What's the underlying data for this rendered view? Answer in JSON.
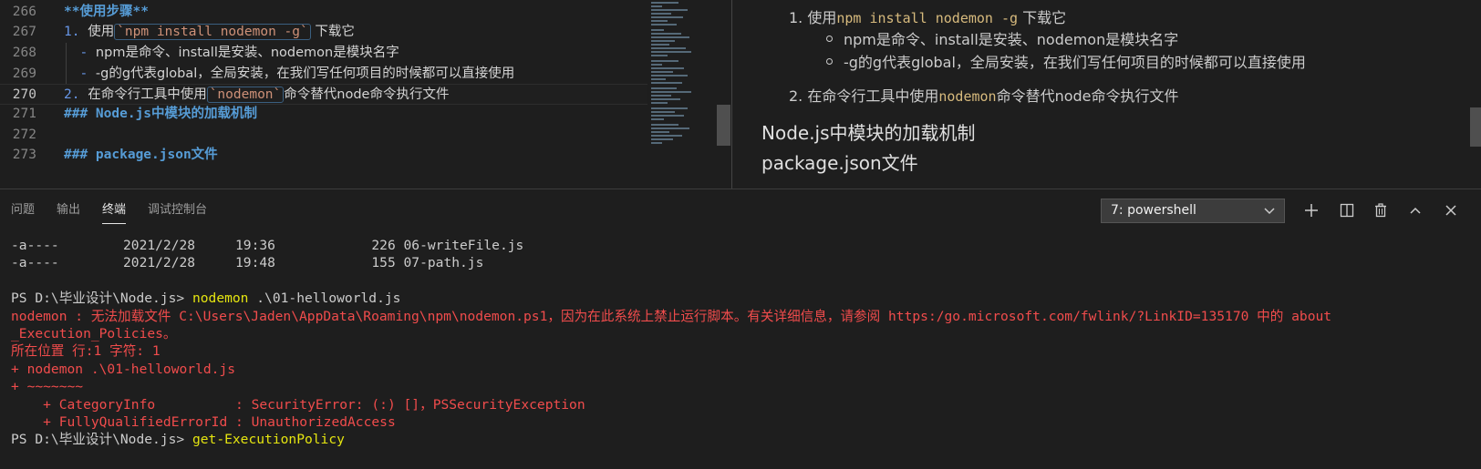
{
  "editor": {
    "lines": [
      {
        "num": "266",
        "parts": [
          {
            "t": "**使用步骤**",
            "c": "bold-cyan"
          }
        ]
      },
      {
        "num": "267",
        "parts": [
          {
            "t": "1. ",
            "c": "list-num"
          },
          {
            "t": "使用",
            "c": "plain cn"
          },
          {
            "t": "`npm install nodemon -g`",
            "c": "inline-code"
          },
          {
            "t": " 下载它",
            "c": "plain cn"
          }
        ]
      },
      {
        "num": "268",
        "parts": [
          {
            "t": "  - ",
            "c": "list-num"
          },
          {
            "t": "npm是命令、install是安装、nodemon是模块名字",
            "c": "plain cn"
          }
        ]
      },
      {
        "num": "269",
        "parts": [
          {
            "t": "  - ",
            "c": "list-num"
          },
          {
            "t": "-g的g代表global，全局安装，在我们写任何项目的时候都可以直接使用",
            "c": "plain cn"
          }
        ]
      },
      {
        "num": "270",
        "parts": [
          {
            "t": "2. ",
            "c": "list-num"
          },
          {
            "t": "在命令行工具中使用",
            "c": "plain cn"
          },
          {
            "t": "`nodemon`",
            "c": "inline-code"
          },
          {
            "t": "命令替代node命令执行文件",
            "c": "plain cn"
          }
        ]
      },
      {
        "num": "271",
        "parts": [
          {
            "t": "### Node.js中模块的加载机制",
            "c": "heading"
          }
        ]
      },
      {
        "num": "272",
        "parts": []
      },
      {
        "num": "273",
        "parts": [
          {
            "t": "### package.json文件",
            "c": "heading"
          }
        ]
      }
    ],
    "current_line": "270"
  },
  "preview": {
    "item1_prefix": "1. 使用",
    "item1_code": "npm install nodemon -g",
    "item1_suffix": " 下载它",
    "sub1": "npm是命令、install是安装、nodemon是模块名字",
    "sub2": "-g的g代表global，全局安装，在我们写任何项目的时候都可以直接使用",
    "item2_prefix": "2. 在命令行工具中使用",
    "item2_code": "nodemon",
    "item2_suffix": "命令替代node命令执行文件",
    "heading1": "Node.js中模块的加载机制",
    "heading2": "package.json文件"
  },
  "panel": {
    "tabs": {
      "problems": "问题",
      "output": "输出",
      "terminal": "终端",
      "debug": "调试控制台"
    },
    "terminal_select": "7: powershell",
    "icons": [
      "plus-icon",
      "split-icon",
      "trash-icon",
      "chevron-up-icon",
      "close-icon"
    ]
  },
  "terminal": {
    "lines": [
      {
        "t": "-a----        2021/2/28     19:36            226 06-writeFile.js",
        "c": "t-normal"
      },
      {
        "t": "-a----        2021/2/28     19:48            155 07-path.js",
        "c": "t-normal"
      },
      {
        "t": "",
        "c": "t-normal"
      },
      {
        "prompt": "PS D:\\毕业设计\\Node.js> ",
        "cmd": "nodemon",
        "rest": " .\\01-helloworld.js"
      },
      {
        "t": "nodemon : 无法加载文件 C:\\Users\\Jaden\\AppData\\Roaming\\npm\\nodemon.ps1，因为在此系统上禁止运行脚本。有关详细信息，请参阅 https:/go.microsoft.com/fwlink/?LinkID=135170 中的 about",
        "c": "t-err"
      },
      {
        "t": "_Execution_Policies。",
        "c": "t-err"
      },
      {
        "t": "所在位置 行:1 字符: 1",
        "c": "t-err"
      },
      {
        "t": "+ nodemon .\\01-helloworld.js",
        "c": "t-err"
      },
      {
        "t": "+ ~~~~~~~",
        "c": "t-err"
      },
      {
        "t": "    + CategoryInfo          : SecurityError: (:) []，PSSecurityException",
        "c": "t-err"
      },
      {
        "t": "    + FullyQualifiedErrorId : UnauthorizedAccess",
        "c": "t-err"
      },
      {
        "prompt": "PS D:\\毕业设计\\Node.js> ",
        "cmd": "get-ExecutionPolicy",
        "rest": ""
      }
    ]
  }
}
